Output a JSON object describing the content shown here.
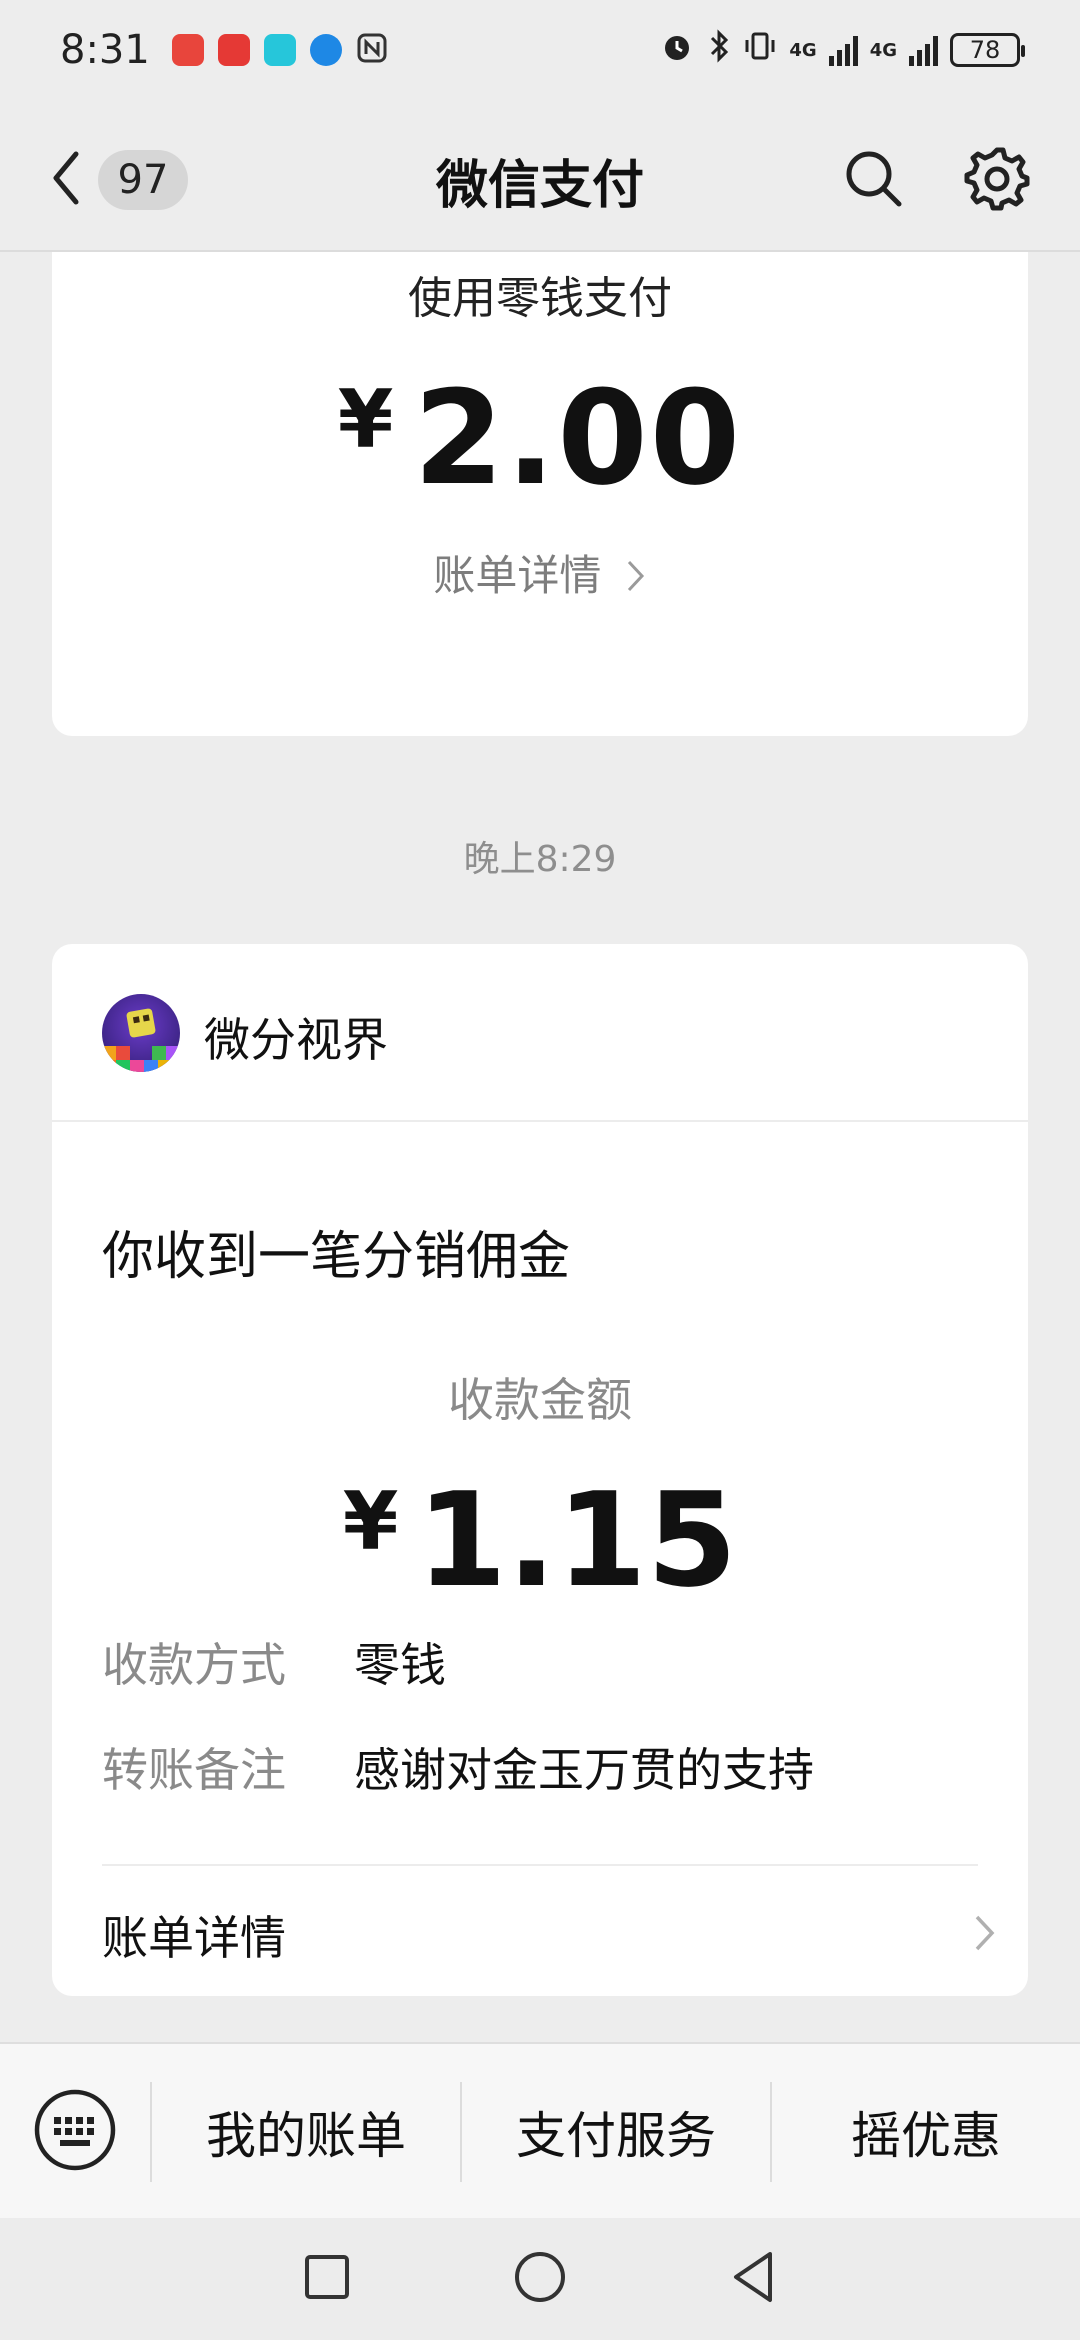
{
  "status_bar": {
    "time": "8:31",
    "network_1": "4G",
    "network_2": "4G",
    "battery": "78"
  },
  "nav": {
    "unread_count": "97",
    "title": "微信支付"
  },
  "card1": {
    "title": "使用零钱支付",
    "currency": "¥",
    "amount": "2.00",
    "link": "账单详情"
  },
  "timestamp": "晚上8:29",
  "card2": {
    "merchant": "微分视界",
    "notify_title": "你收到一笔分销佣金",
    "amount_label": "收款金额",
    "currency": "¥",
    "amount": "1.15",
    "rows": [
      {
        "key": "收款方式",
        "value": "零钱"
      },
      {
        "key": "转账备注",
        "value": "感谢对金玉万贯的支持"
      }
    ],
    "bill_link": "账单详情"
  },
  "bottom_menu": {
    "items": [
      "我的账单",
      "支付服务",
      "摇优惠"
    ]
  },
  "colors": {
    "background": "#ededed",
    "card": "#ffffff",
    "secondary_text": "#8a8a8a"
  }
}
